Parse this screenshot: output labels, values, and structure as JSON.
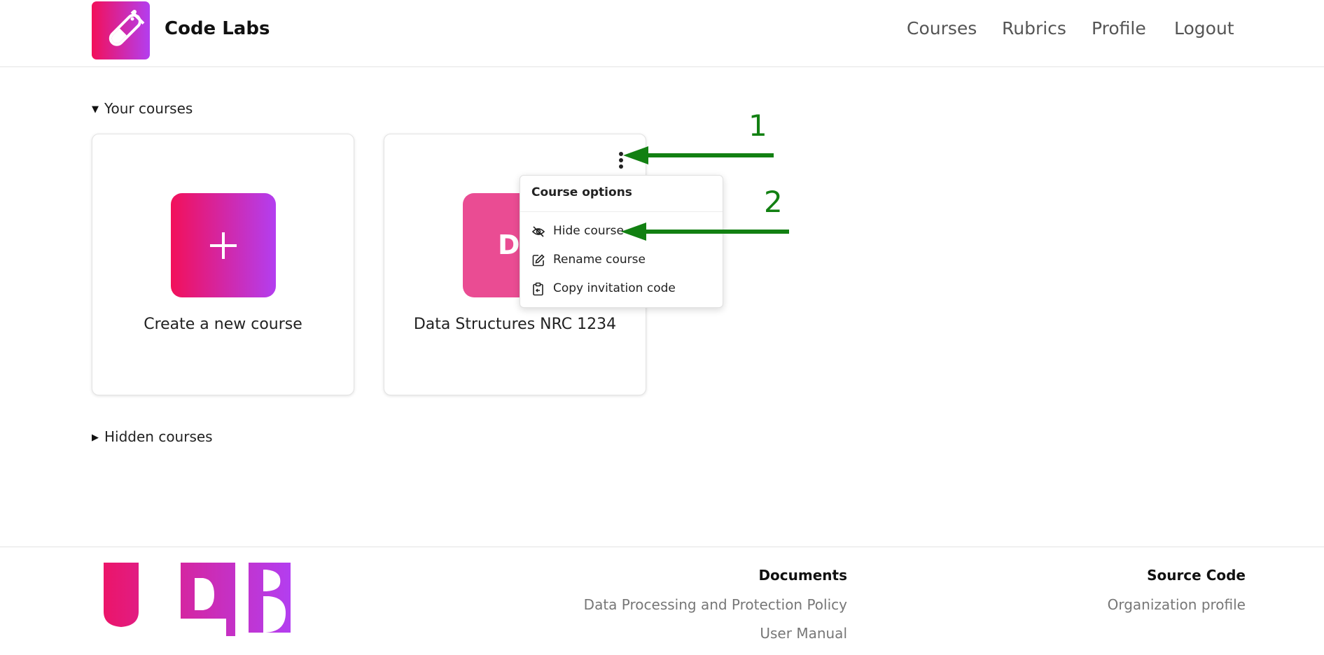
{
  "header": {
    "brand": "Code Labs",
    "nav": [
      "Courses",
      "Rubrics",
      "Profile",
      "Logout"
    ]
  },
  "sections": {
    "your_courses": "Your courses",
    "hidden_courses": "Hidden courses"
  },
  "cards": {
    "create_label": "Create a new course",
    "create_icon_text": "+",
    "course_initial": "D",
    "course_label": "Data Structures NRC 1234"
  },
  "course_menu": {
    "title": "Course options",
    "items": [
      "Hide course",
      "Rename course",
      "Copy invitation code"
    ]
  },
  "annotations": [
    "1",
    "2"
  ],
  "footer": {
    "logo_text": "UDB",
    "documents_heading": "Documents",
    "documents_links": [
      "Data Processing and Protection Policy",
      "User Manual"
    ],
    "source_heading": "Source Code",
    "source_links": [
      "Organization profile"
    ]
  },
  "colors": {
    "brand_gradient_start": "#f2105a",
    "brand_gradient_end": "#b33ef0",
    "course_tile": "#ea4c93",
    "annotation_arrow": "#128012"
  }
}
